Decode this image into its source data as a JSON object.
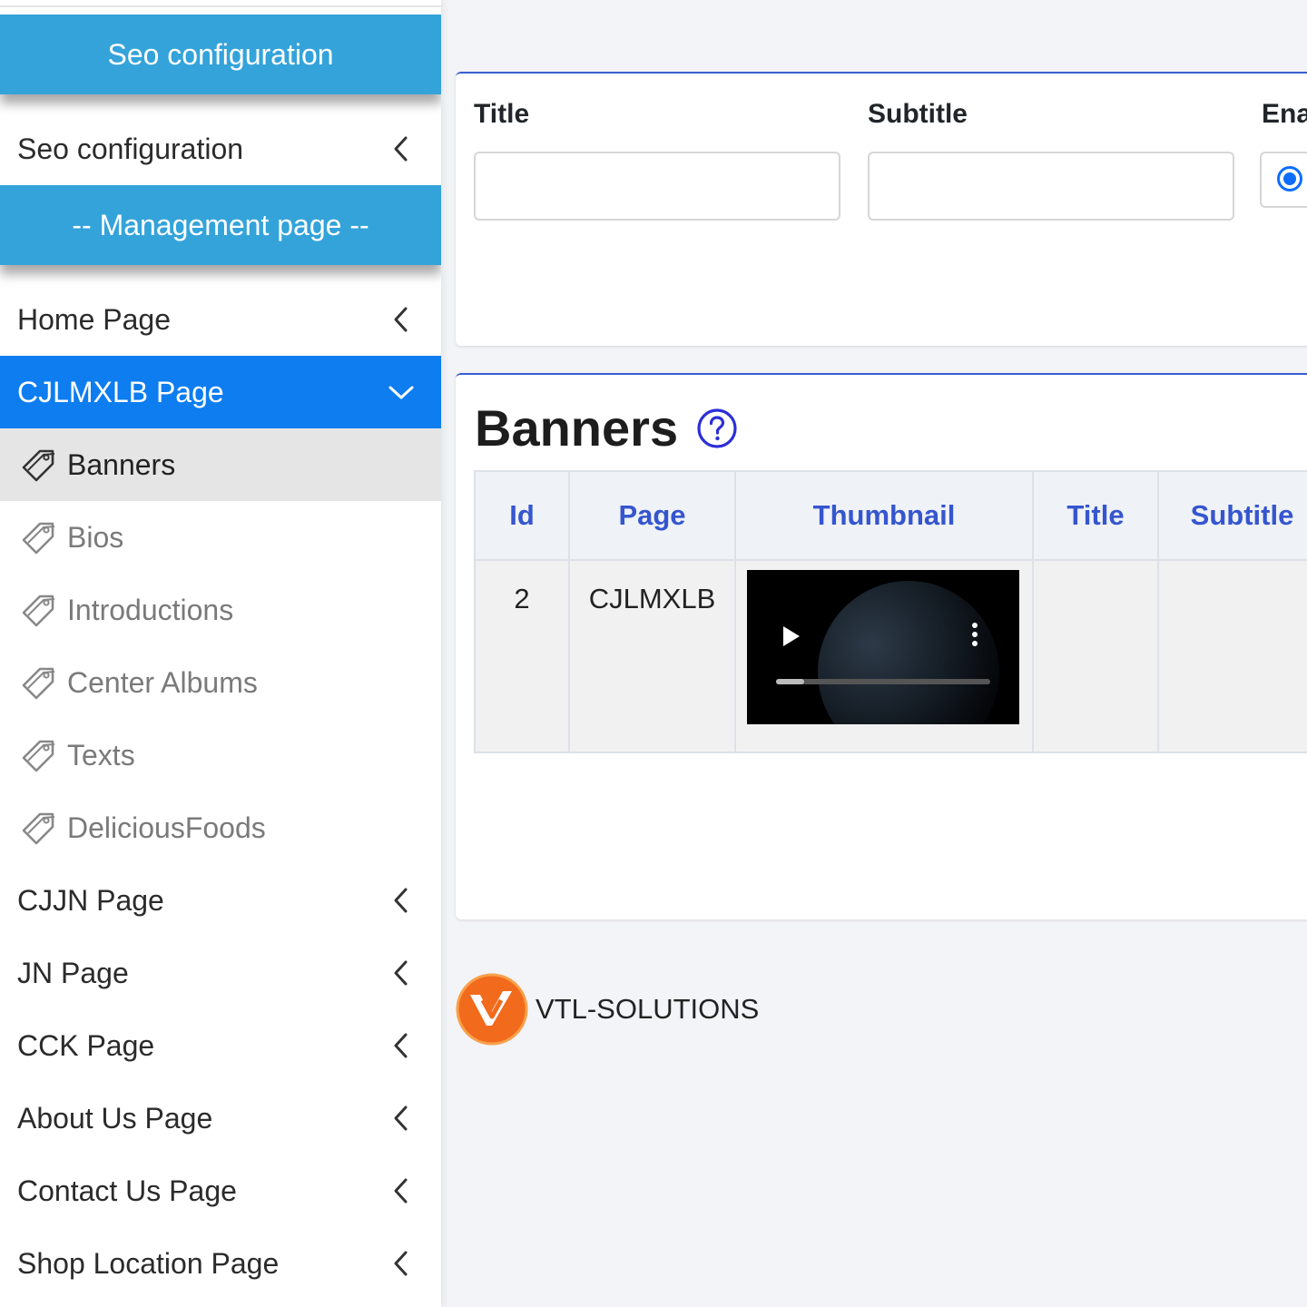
{
  "sidebar": {
    "seo_header": "Seo configuration",
    "seo_item": "Seo configuration",
    "management_header": "-- Management page --",
    "items": [
      {
        "label": "Home Page"
      },
      {
        "label": "CJLMXLB Page"
      },
      {
        "label": "CJJN Page"
      },
      {
        "label": "JN Page"
      },
      {
        "label": "CCK Page"
      },
      {
        "label": "About Us Page"
      },
      {
        "label": "Contact Us Page"
      },
      {
        "label": "Shop Location Page"
      }
    ],
    "submenu": [
      {
        "label": "Banners"
      },
      {
        "label": "Bios"
      },
      {
        "label": "Introductions"
      },
      {
        "label": "Center Albums"
      },
      {
        "label": "Texts"
      },
      {
        "label": "DeliciousFoods"
      }
    ]
  },
  "form": {
    "title_label": "Title",
    "subtitle_label": "Subtitle",
    "enabled_label": "Ena",
    "title_value": "",
    "subtitle_value": ""
  },
  "banners": {
    "heading": "Banners",
    "columns": [
      "Id",
      "Page",
      "Thumbnail",
      "Title",
      "Subtitle"
    ],
    "rows": [
      {
        "id": "2",
        "page": "CJLMXLB",
        "title": "",
        "subtitle": "",
        "video_progress": 0.13
      }
    ]
  },
  "brand": {
    "name": "VTL-SOLUTIONS"
  },
  "colors": {
    "section_header": "#34a3da",
    "active_item": "#0d7df0",
    "table_header_text": "#3556cf",
    "logo": "#f26a1b"
  }
}
